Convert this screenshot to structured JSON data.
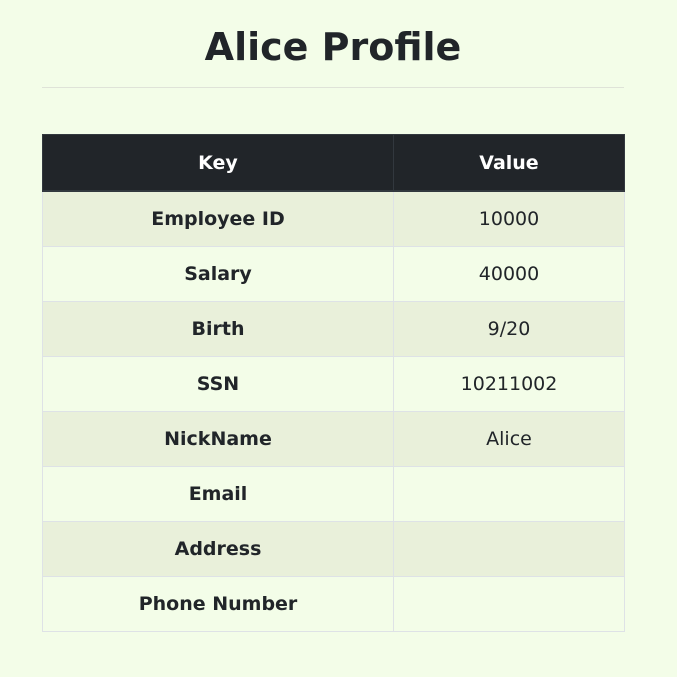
{
  "page": {
    "title": "Alice Profile"
  },
  "table": {
    "headers": [
      "Key",
      "Value"
    ],
    "rows": [
      {
        "key": "Employee ID",
        "value": "10000"
      },
      {
        "key": "Salary",
        "value": "40000"
      },
      {
        "key": "Birth",
        "value": "9/20"
      },
      {
        "key": "SSN",
        "value": "10211002"
      },
      {
        "key": "NickName",
        "value": "Alice"
      },
      {
        "key": "Email",
        "value": ""
      },
      {
        "key": "Address",
        "value": ""
      },
      {
        "key": "Phone Number",
        "value": ""
      }
    ]
  },
  "colors": {
    "background": "#f3fde8",
    "header_background": "#212529",
    "stripe": "#e9f0da",
    "text": "#212529"
  }
}
